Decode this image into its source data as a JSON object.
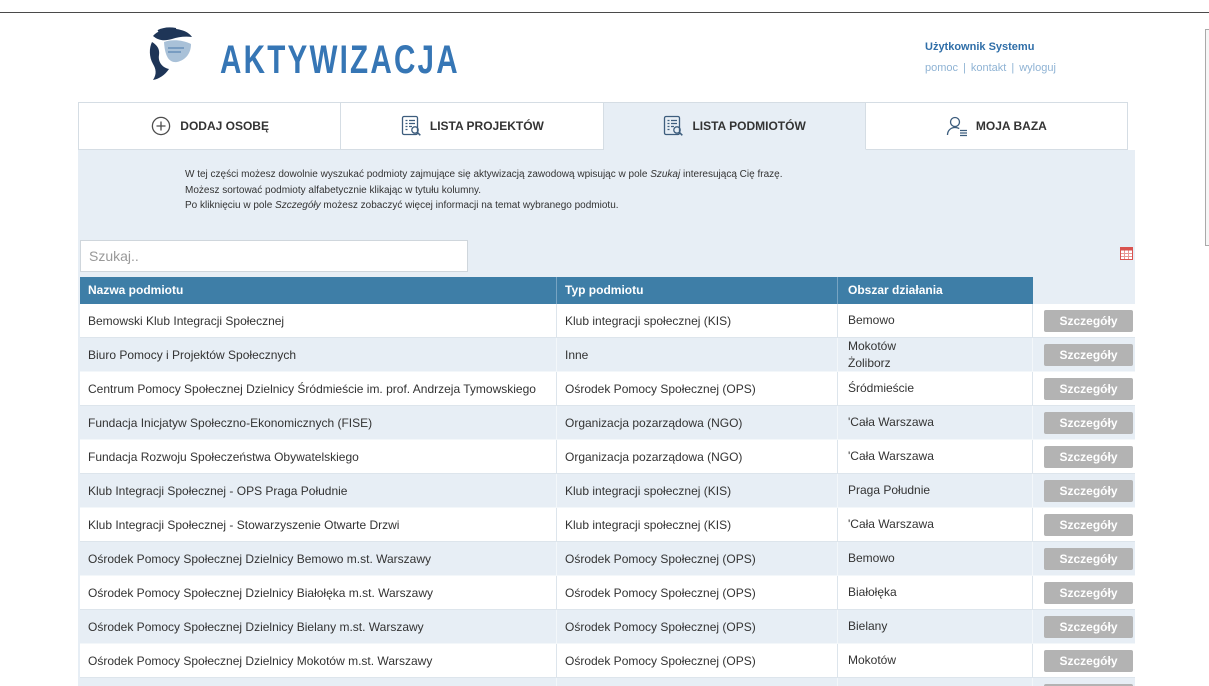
{
  "app": {
    "title": "AKTYWIZACJA",
    "user": {
      "name": "Użytkownik Systemu",
      "links": [
        "pomoc",
        "kontakt",
        "wyloguj"
      ],
      "separator": "|"
    }
  },
  "nav": {
    "tabs": [
      {
        "label": "DODAJ OSOBĘ",
        "icon": "plus-circle-icon",
        "active": false
      },
      {
        "label": "LISTA PROJEKTÓW",
        "icon": "list-search-icon",
        "active": false
      },
      {
        "label": "LISTA PODMIOTÓW",
        "icon": "list-search-icon",
        "active": true
      },
      {
        "label": "MOJA BAZA",
        "icon": "user-list-icon",
        "active": false
      }
    ]
  },
  "info": {
    "line1": {
      "before": "W tej części możesz dowolnie wyszukać podmioty zajmujące się aktywizacją zawodową wpisując w pole ",
      "emphasis": "Szukaj",
      "after": " interesującą Cię frazę."
    },
    "line2": "Możesz sortować podmioty alfabetycznie klikając w tytułu kolumny.",
    "line3": {
      "before": "Po kliknięciu w pole ",
      "emphasis": "Szczegóły",
      "after": " możesz zobaczyć więcej informacji na temat wybranego podmiotu."
    }
  },
  "search": {
    "placeholder": "Szukaj.."
  },
  "toolbar": {
    "export_icon": "table-export-icon"
  },
  "table": {
    "columns": [
      "Nazwa podmiotu",
      "Typ podmiotu",
      "Obszar działania"
    ],
    "details_label": "Szczegóły",
    "rows": [
      {
        "name": "Bemowski Klub Integracji Społecznej",
        "type": "Klub integracji społecznej (KIS)",
        "area": [
          "Bemowo"
        ]
      },
      {
        "name": "Biuro Pomocy i Projektów Społecznych",
        "type": "Inne",
        "area": [
          "Mokotów",
          "Żoliborz"
        ]
      },
      {
        "name": "Centrum Pomocy Społecznej Dzielnicy Śródmieście im. prof. Andrzeja Tymowskiego",
        "type": "Ośrodek Pomocy Społecznej (OPS)",
        "area": [
          "Śródmieście"
        ]
      },
      {
        "name": "Fundacja Inicjatyw Społeczno-Ekonomicznych (FISE)",
        "type": "Organizacja pozarządowa (NGO)",
        "area": [
          "'Cała Warszawa"
        ]
      },
      {
        "name": "Fundacja Rozwoju Społeczeństwa Obywatelskiego",
        "type": "Organizacja pozarządowa (NGO)",
        "area": [
          "'Cała Warszawa"
        ]
      },
      {
        "name": "Klub Integracji Społecznej - OPS Praga Południe",
        "type": "Klub integracji społecznej (KIS)",
        "area": [
          "Praga Południe"
        ]
      },
      {
        "name": "Klub Integracji Społecznej - Stowarzyszenie Otwarte Drzwi",
        "type": "Klub integracji społecznej (KIS)",
        "area": [
          "'Cała Warszawa"
        ]
      },
      {
        "name": "Ośrodek Pomocy Społecznej Dzielnicy Bemowo m.st. Warszawy",
        "type": "Ośrodek Pomocy Społecznej (OPS)",
        "area": [
          "Bemowo"
        ]
      },
      {
        "name": "Ośrodek Pomocy Społecznej Dzielnicy Białołęka m.st. Warszawy",
        "type": "Ośrodek Pomocy Społecznej (OPS)",
        "area": [
          "Białołęka"
        ]
      },
      {
        "name": "Ośrodek Pomocy Społecznej Dzielnicy Bielany m.st. Warszawy",
        "type": "Ośrodek Pomocy Społecznej (OPS)",
        "area": [
          "Bielany"
        ]
      },
      {
        "name": "Ośrodek Pomocy Społecznej Dzielnicy Mokotów m.st. Warszawy",
        "type": "Ośrodek Pomocy Społecznej (OPS)",
        "area": [
          "Mokotów"
        ]
      }
    ]
  },
  "colors": {
    "brand": "#3676b5",
    "user_name": "#2f6ea8",
    "user_link": "#8fb3d4",
    "table_header": "#3e7ea7",
    "content_bg": "#e7eef5",
    "button_bg": "#b3b3b3",
    "export_icon": "#d9534f"
  }
}
